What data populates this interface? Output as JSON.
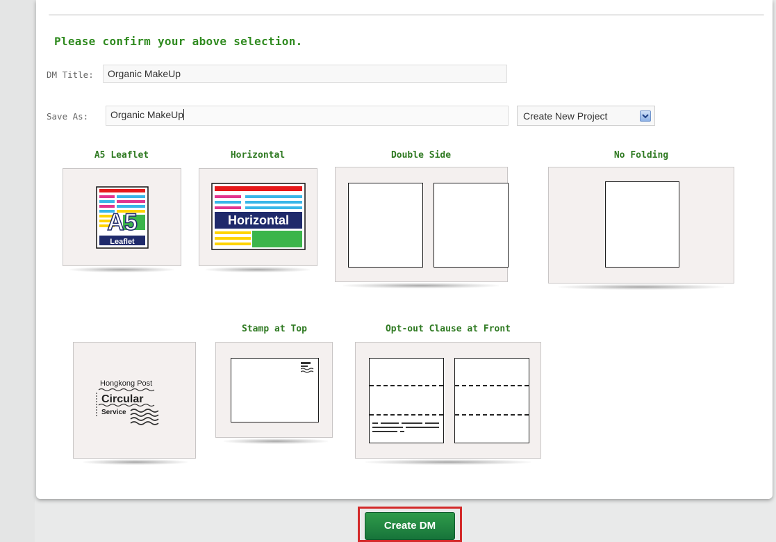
{
  "heading": "Please confirm your above selection.",
  "dm_title": {
    "label": "DM Title:",
    "value": "Organic MakeUp"
  },
  "save_as": {
    "label": "Save As:",
    "value": "Organic MakeUp"
  },
  "project_select": {
    "selected": "Create New Project"
  },
  "options_row1": [
    {
      "label": "A5 Leaflet"
    },
    {
      "label": "Horizontal"
    },
    {
      "label": "Double Side"
    },
    {
      "label": "No Folding"
    }
  ],
  "options_row2": [
    {
      "label": ""
    },
    {
      "label": "Stamp at Top"
    },
    {
      "label": "Opt-out Clause at Front"
    }
  ],
  "thumbnails": {
    "a5_big": "A5",
    "a5_small": "Leaflet",
    "horizontal": "Horizontal",
    "hkpost_line1": "Hongkong Post",
    "hkpost_line2": "Circular",
    "hkpost_line3": "Service"
  },
  "create_button": "Create DM",
  "colors": {
    "label_green": "#2f7a22",
    "heading_green": "#2f8a1f",
    "button_green": "#17743a",
    "highlight_red": "#d32a2a"
  }
}
